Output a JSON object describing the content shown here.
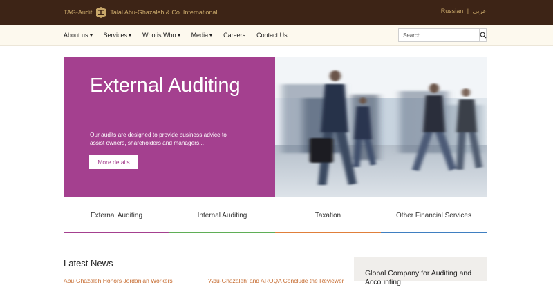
{
  "header": {
    "brand_short": "TAG-Audit",
    "brand_full": "Talal Abu-Ghazaleh & Co. International",
    "lang_primary": "Russian",
    "lang_separator": "|",
    "lang_secondary": "عربي"
  },
  "nav": {
    "items": [
      {
        "label": "About us",
        "dropdown": true
      },
      {
        "label": "Services",
        "dropdown": true
      },
      {
        "label": "Who is Who",
        "dropdown": true
      },
      {
        "label": "Media",
        "dropdown": true
      },
      {
        "label": "Careers",
        "dropdown": false
      },
      {
        "label": "Contact Us",
        "dropdown": false
      }
    ],
    "search_placeholder": "Search..."
  },
  "hero": {
    "title": "External Auditing",
    "description": "Our audits are designed to provide business advice to assist owners, shareholders and managers...",
    "button_label": "More details"
  },
  "tabs": [
    {
      "label": "External Auditing",
      "color": "#a4408f"
    },
    {
      "label": "Internal Auditing",
      "color": "#5fae56"
    },
    {
      "label": "Taxation",
      "color": "#e07f3a"
    },
    {
      "label": "Other Financial Services",
      "color": "#3f7fc1"
    }
  ],
  "news": {
    "heading": "Latest News",
    "items": [
      "Abu-Ghazaleh Honors Jordanian Workers",
      "'Abu-Ghazaleh' and AROQA Conclude the Reviewer"
    ]
  },
  "sidebar": {
    "title": "Global Company for Auditing and Accounting"
  },
  "colors": {
    "topbar": "#3d2416",
    "gold": "#c9a86a",
    "hero_accent": "#a4408f",
    "link": "#c56a2e"
  }
}
